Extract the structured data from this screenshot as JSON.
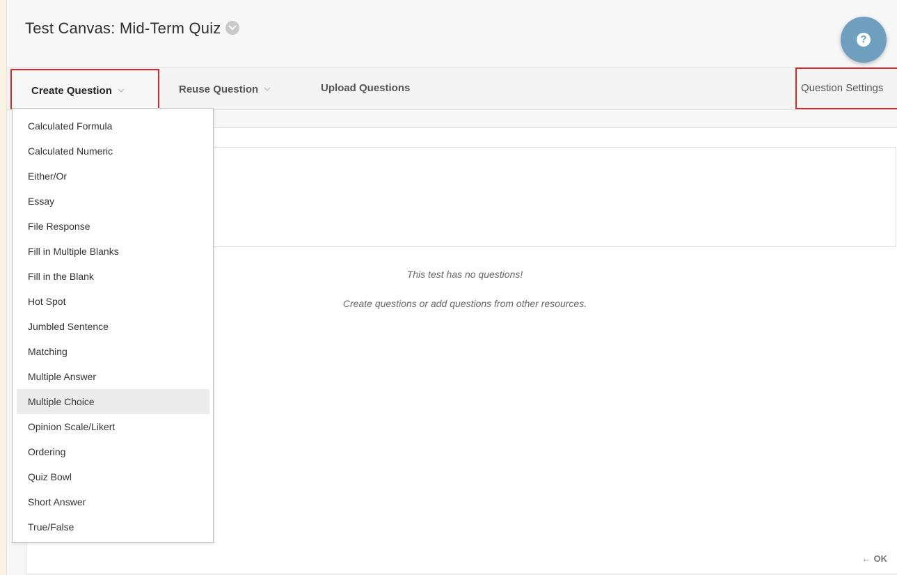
{
  "header": {
    "title": "Test Canvas: Mid-Term Quiz",
    "help_icon": "?"
  },
  "toolbar": {
    "create_label": "Create Question",
    "reuse_label": "Reuse Question",
    "upload_label": "Upload Questions",
    "settings_label": "Question Settings"
  },
  "dropdown": {
    "selected": "Multiple Choice",
    "items": [
      "Calculated Formula",
      "Calculated Numeric",
      "Either/Or",
      "Essay",
      "File Response",
      "Fill in Multiple Blanks",
      "Fill in the Blank",
      "Hot Spot",
      "Jumbled Sentence",
      "Matching",
      "Multiple Answer",
      "Multiple Choice",
      "Opinion Scale/Likert",
      "Ordering",
      "Quiz Bowl",
      "Short Answer",
      "True/False"
    ]
  },
  "content": {
    "empty_title": "This test has no questions!",
    "empty_hint": "Create questions or add questions from other resources."
  },
  "footer": {
    "arrow": "←",
    "ok_label": "OK"
  },
  "colors": {
    "highlight_border": "#d42a2a",
    "help_button": "#6f9fbf",
    "selected_item_bg": "#ececec"
  }
}
